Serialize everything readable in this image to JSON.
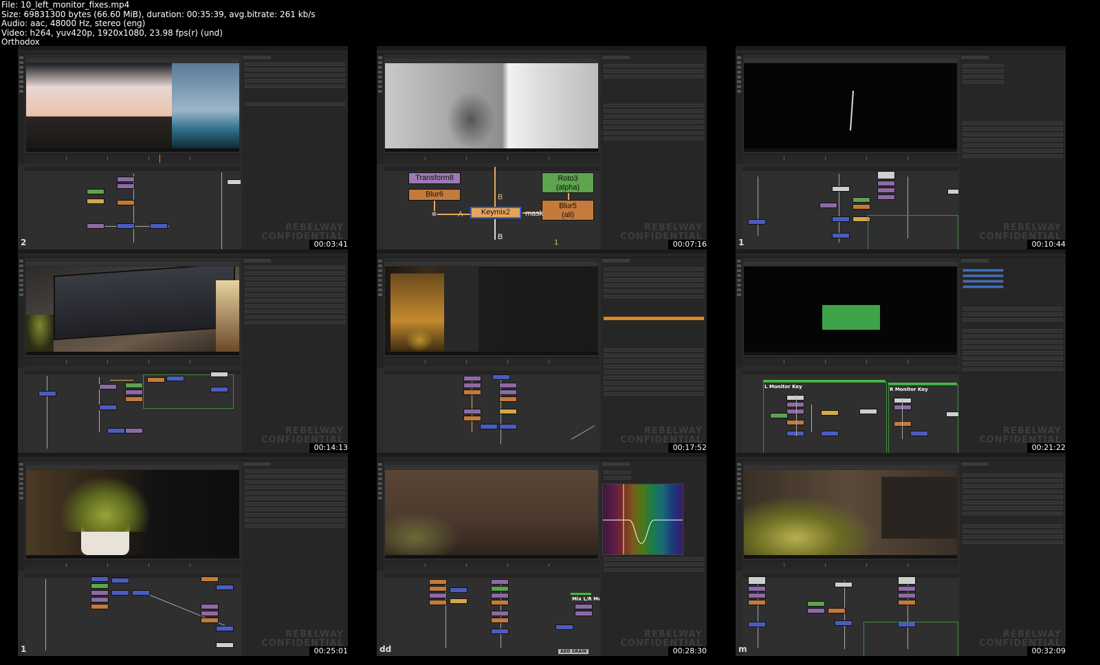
{
  "file_info": {
    "line1": "File: 10_left_monitor_fixes.mp4",
    "line2": "Size: 69831300 bytes (66.60 MiB), duration: 00:35:39, avg.bitrate: 261 kb/s",
    "line3": "Audio: aac, 48000 Hz, stereo (eng)",
    "line4": "Video: h264, yuv420p, 1920x1080, 23.98 fps(r) (und)",
    "line5": "Orthodox"
  },
  "watermark": {
    "line1": "REBELWAY",
    "line2": "CONFIDENTIAL"
  },
  "thumbnails": [
    {
      "timestamp": "00:03:41",
      "corner_label": "2"
    },
    {
      "timestamp": "00:07:16",
      "corner_label": "",
      "nodes": {
        "transform": "Transform8",
        "blur6": "Blur6",
        "keymix": "Keymix2",
        "roto": "Roto3",
        "roto_sub": "(alpha)",
        "blur5": "Blur5",
        "blur5_sub": "(all)",
        "input_a": "A",
        "input_b": "B",
        "input_mask": "mask",
        "arrow_b": "B",
        "number_1": "1"
      }
    },
    {
      "timestamp": "00:10:44",
      "corner_label": "1"
    },
    {
      "timestamp": "00:14:13",
      "corner_label": ""
    },
    {
      "timestamp": "00:17:52",
      "corner_label": ""
    },
    {
      "timestamp": "00:21:22",
      "corner_label": "",
      "labels": {
        "left_key": "L Monitor Key",
        "right_key": "R Monitor Key"
      }
    },
    {
      "timestamp": "00:25:01",
      "corner_label": "1"
    },
    {
      "timestamp": "00:28:30",
      "corner_label": "dd",
      "labels": {
        "mix": "Mix L/R Mon",
        "grain": "ADD GRAIN"
      }
    },
    {
      "timestamp": "00:32:09",
      "corner_label": "m"
    }
  ]
}
